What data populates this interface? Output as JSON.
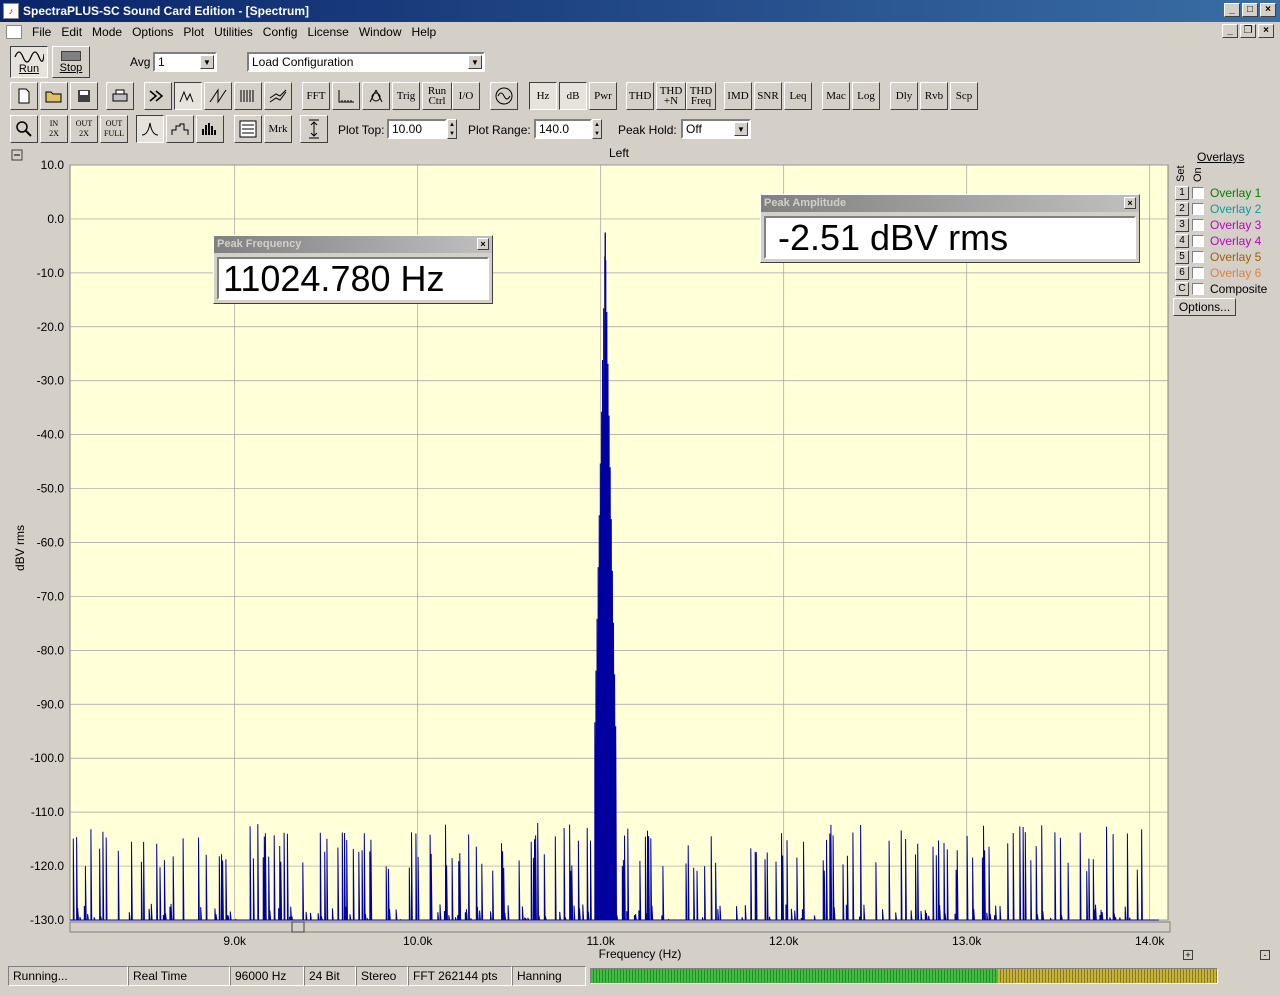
{
  "window": {
    "title": "SpectraPLUS-SC Sound Card Edition - [Spectrum]"
  },
  "menu": [
    "File",
    "Edit",
    "Mode",
    "Options",
    "Plot",
    "Utilities",
    "Config",
    "License",
    "Window",
    "Help"
  ],
  "toolbar1": {
    "run_label": "Run",
    "stop_label": "Stop",
    "avg_label": "Avg",
    "avg_value": "1",
    "config_value": "Load Configuration"
  },
  "toolbar2": {
    "buttons": [
      "FFT",
      "Trig",
      "Run Ctrl",
      "I/O",
      "Hz",
      "dB",
      "Pwr",
      "THD",
      "THD +N",
      "THD Freq",
      "IMD",
      "SNR",
      "Leq",
      "Mac",
      "Log",
      "Dly",
      "Rvb",
      "Scp"
    ]
  },
  "toolbar3": {
    "mrk_label": "Mrk",
    "plot_top_label": "Plot Top:",
    "plot_top_value": "10.00",
    "plot_range_label": "Plot Range:",
    "plot_range_value": "140.0",
    "peak_hold_label": "Peak Hold:",
    "peak_hold_value": "Off"
  },
  "chart_data": {
    "type": "line",
    "title": "Left",
    "xlabel": "Frequency (Hz)",
    "ylabel": "dBV rms",
    "xlim": [
      8100,
      14100
    ],
    "ylim": [
      -130,
      10
    ],
    "x_ticks": [
      9000,
      10000,
      11000,
      12000,
      13000,
      14000
    ],
    "x_tick_labels": [
      "9.0k",
      "10.0k",
      "11.0k",
      "12.0k",
      "13.0k",
      "14.0k"
    ],
    "y_ticks": [
      10,
      0,
      -10,
      -20,
      -30,
      -40,
      -50,
      -60,
      -70,
      -80,
      -90,
      -100,
      -110,
      -120,
      -130
    ],
    "y_tick_labels": [
      "10.0",
      "0.0",
      "-10.0",
      "-20.0",
      "-30.0",
      "-40.0",
      "-50.0",
      "-60.0",
      "-70.0",
      "-80.0",
      "-90.0",
      "-100.0",
      "-110.0",
      "-120.0",
      "-130.0"
    ],
    "grid": true,
    "background": "#ffffd8",
    "series_color": "#0000a0",
    "peak": {
      "x": 11024.78,
      "y": -2.51
    },
    "noise_floor": -130,
    "spur_level_range": [
      -121,
      -112
    ]
  },
  "peak_frequency": {
    "title": "Peak Frequency",
    "value": "11024.780 Hz"
  },
  "peak_amplitude": {
    "title": "Peak Amplitude",
    "value": "-2.51 dBV rms"
  },
  "overlays": {
    "title": "Overlays",
    "set_label": "Set",
    "on_label": "On",
    "items": [
      {
        "num": "1",
        "label": "Overlay 1",
        "color": "#008000"
      },
      {
        "num": "2",
        "label": "Overlay 2",
        "color": "#00a0a0"
      },
      {
        "num": "3",
        "label": "Overlay 3",
        "color": "#c000c0"
      },
      {
        "num": "4",
        "label": "Overlay 4",
        "color": "#c000c0"
      },
      {
        "num": "5",
        "label": "Overlay 5",
        "color": "#a06000"
      },
      {
        "num": "6",
        "label": "Overlay 6",
        "color": "#e08040"
      },
      {
        "num": "C",
        "label": "Composite",
        "color": "#000000"
      }
    ],
    "options_label": "Options..."
  },
  "status": {
    "state": "Running...",
    "mode": "Real Time",
    "rate": "96000 Hz",
    "bits": "24 Bit",
    "channels": "Stereo",
    "fft": "FFT 262144 pts",
    "window": "Hanning"
  }
}
